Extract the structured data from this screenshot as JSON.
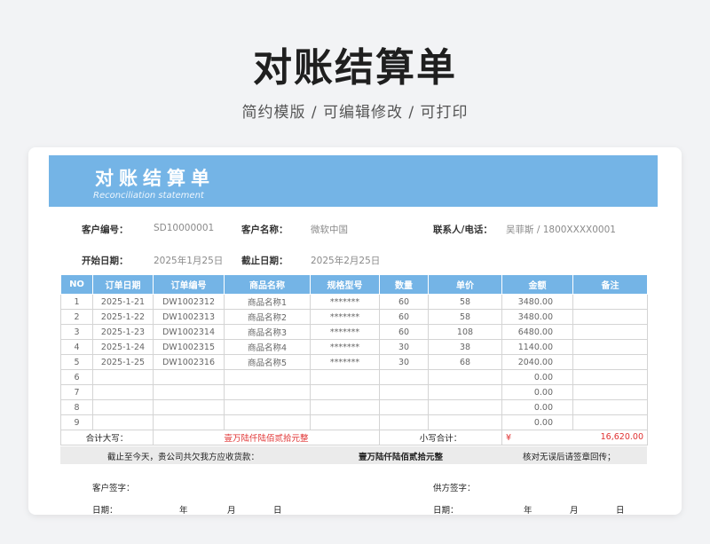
{
  "hero": {
    "title": "对账结算单",
    "subtitle": "简约模版 / 可编辑修改 / 可打印"
  },
  "banner": {
    "title": "对账结算单",
    "subtitle_en": "Reconciliation statement"
  },
  "info": {
    "customer_no_label": "客户编号：",
    "customer_no": "SD10000001",
    "customer_name_label": "客户名称：",
    "customer_name": "微软中国",
    "contact_label": "联系人/电话：",
    "contact": "吴菲斯 / 1800XXXX0001",
    "start_label": "开始日期：",
    "start_date": "2025年1月25日",
    "end_label": "截止日期：",
    "end_date": "2025年2月25日"
  },
  "table": {
    "headers": [
      "NO",
      "订单日期",
      "订单编号",
      "商品名称",
      "规格型号",
      "数量",
      "单价",
      "金额",
      "备注"
    ],
    "rows": [
      [
        "1",
        "2025-1-21",
        "DW1002312",
        "商品名称1",
        "*******",
        "60",
        "58",
        "3480.00",
        ""
      ],
      [
        "2",
        "2025-1-22",
        "DW1002313",
        "商品名称2",
        "*******",
        "60",
        "58",
        "3480.00",
        ""
      ],
      [
        "3",
        "2025-1-23",
        "DW1002314",
        "商品名称3",
        "*******",
        "60",
        "108",
        "6480.00",
        ""
      ],
      [
        "4",
        "2025-1-24",
        "DW1002315",
        "商品名称4",
        "*******",
        "30",
        "38",
        "1140.00",
        ""
      ],
      [
        "5",
        "2025-1-25",
        "DW1002316",
        "商品名称5",
        "*******",
        "30",
        "68",
        "2040.00",
        ""
      ],
      [
        "6",
        "",
        "",
        "",
        "",
        "",
        "",
        "0.00",
        ""
      ],
      [
        "7",
        "",
        "",
        "",
        "",
        "",
        "",
        "0.00",
        ""
      ],
      [
        "8",
        "",
        "",
        "",
        "",
        "",
        "",
        "0.00",
        ""
      ],
      [
        "9",
        "",
        "",
        "",
        "",
        "",
        "",
        "0.00",
        ""
      ]
    ],
    "total_upper_label": "合计大写：",
    "total_upper": "壹万陆仟陆佰贰拾元整",
    "total_lower_label": "小写合计：",
    "currency": "¥",
    "total_lower": "16,620.00"
  },
  "summary": {
    "text1": "截止至今天，贵公司共欠我方应收货款：",
    "text2": "壹万陆仟陆佰贰拾元整",
    "text3": "核对无误后请签章回传；"
  },
  "signature": {
    "customer_sign": "客户签字：",
    "supplier_sign": "供方签字：",
    "date_label": "日期：",
    "year": "年",
    "month": "月",
    "day": "日"
  },
  "colors": {
    "accent": "#74b4e6",
    "total_red": "#e03131"
  }
}
